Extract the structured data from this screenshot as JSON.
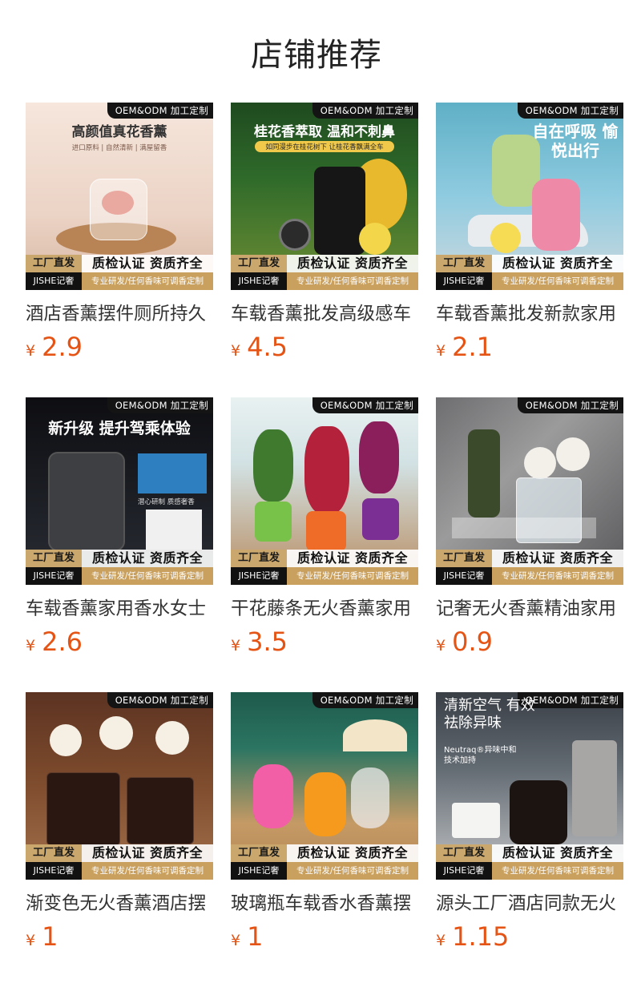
{
  "page_title": "店铺推荐",
  "badges": {
    "oem": "OEM&ODM 加工定制",
    "factory": "工厂直发",
    "brand": "JISHE记奢",
    "quality": "质检认证 资质齐全",
    "rd": "专业研发/任何香味可调香定制"
  },
  "currency": "¥",
  "products": [
    {
      "name": "酒店香薰摆件厕所持久",
      "price": "2.9",
      "headline": "高颜值真花香薰",
      "sub": "进口原料 | 自然清新 | 满屋留香"
    },
    {
      "name": "车载香薰批发高级感车",
      "price": "4.5",
      "headline": "桂花香萃取 温和不刺鼻",
      "sub": "如同漫步在桂花树下 让桂花香飘满全车"
    },
    {
      "name": "车载香薰批发新款家用",
      "price": "2.1",
      "headline": "自在呼吸 愉悦出行",
      "sub": ""
    },
    {
      "name": "车载香薰家用香水女士",
      "price": "2.6",
      "headline": "新升级 提升驾乘体验",
      "sub": "潜心研制 质感奢香"
    },
    {
      "name": "干花藤条无火香薰家用",
      "price": "3.5",
      "headline": "",
      "sub": ""
    },
    {
      "name": "记奢无火香薰精油家用",
      "price": "0.9",
      "headline": "",
      "sub": ""
    },
    {
      "name": "渐变色无火香薰酒店摆",
      "price": "1",
      "headline": "",
      "sub": ""
    },
    {
      "name": "玻璃瓶车载香水香薰摆",
      "price": "1",
      "headline": "",
      "sub": ""
    },
    {
      "name": "源头工厂酒店同款无火",
      "price": "1.15",
      "headline": "清新空气 有效祛除异味",
      "sub": "Neutraq®异味中和 技术加持"
    }
  ]
}
